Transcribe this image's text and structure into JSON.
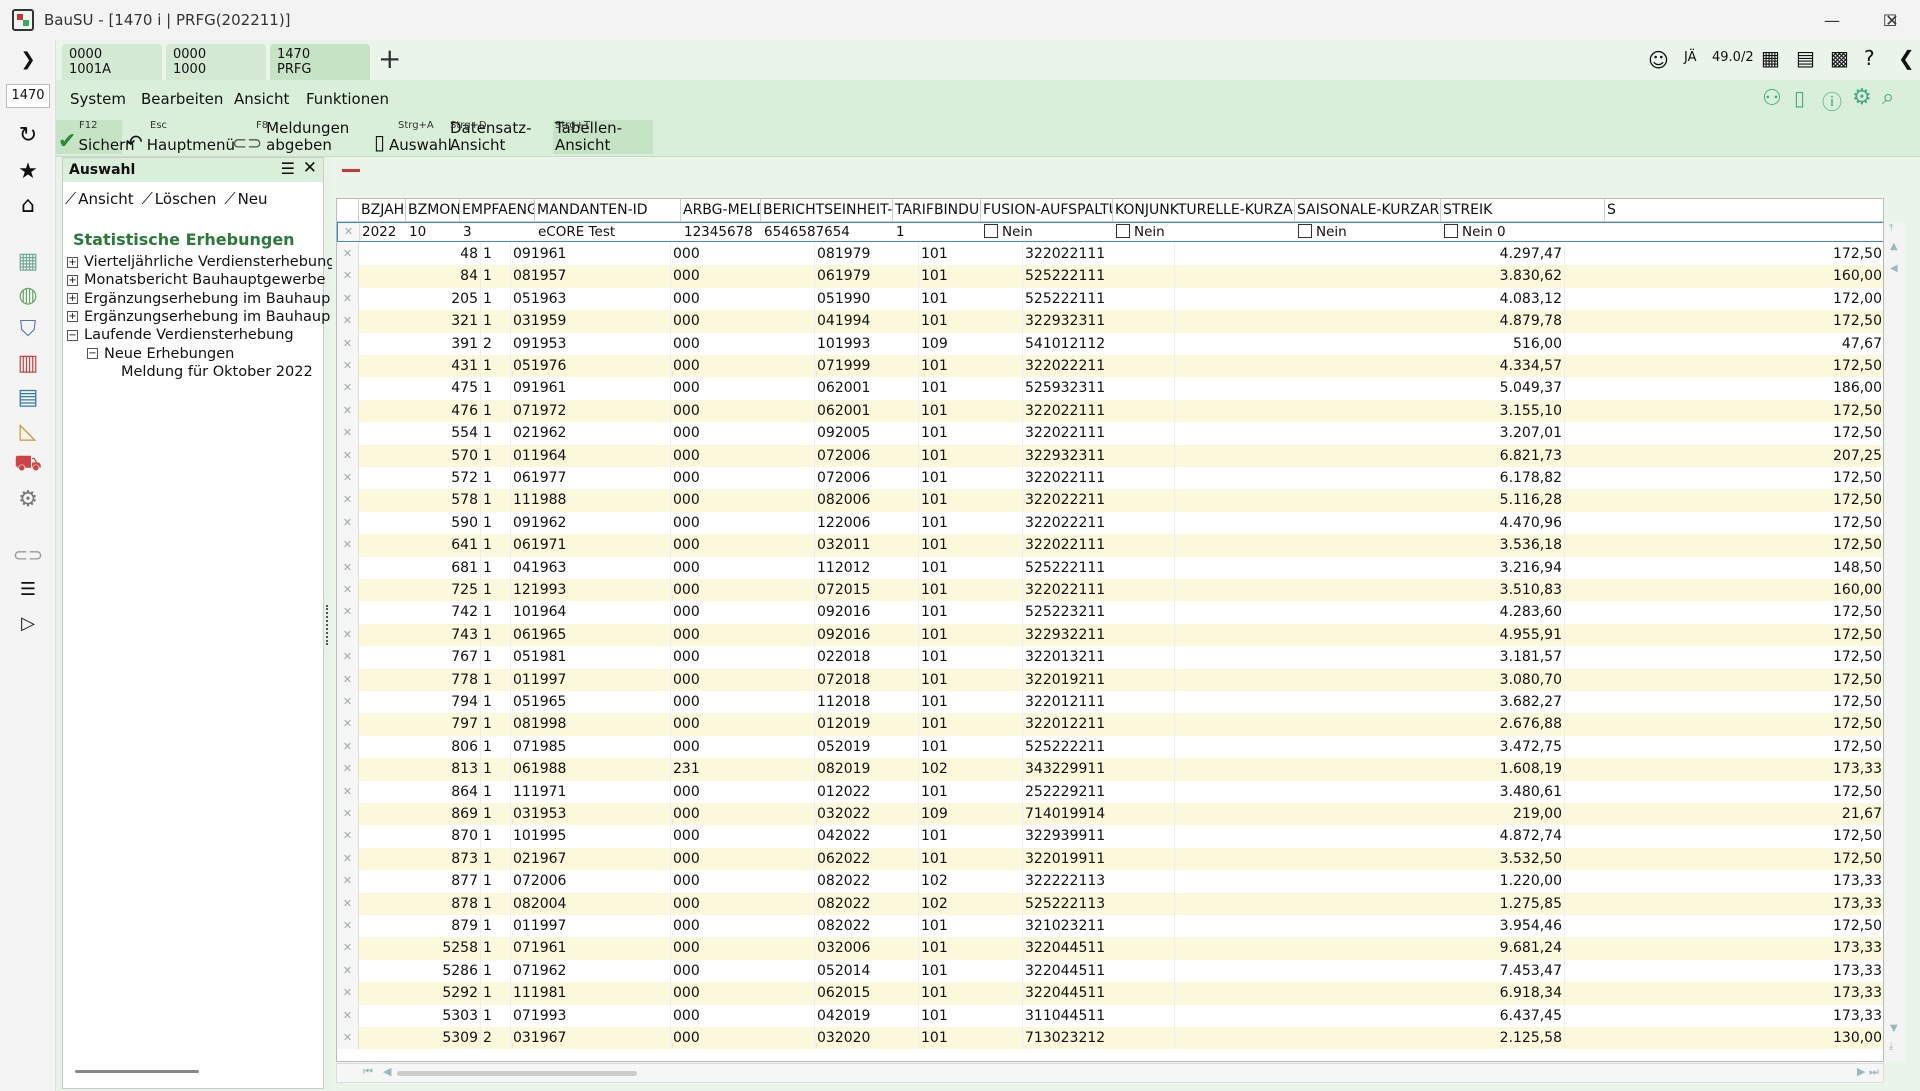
{
  "window": {
    "title": "BauSU - [1470 i | PRFG(202211)]",
    "minimize": "—",
    "maximize": "☐",
    "close": "✕"
  },
  "tabs": [
    {
      "line1": "0000",
      "line2": "1001A"
    },
    {
      "line1": "0000",
      "line2": "1000"
    },
    {
      "line1": "1470",
      "line2": "PRFG"
    }
  ],
  "add_tab": "+",
  "client_field": "1470",
  "user": {
    "initials": "JÄ",
    "version": "49.0/2"
  },
  "menu": [
    "System",
    "Bearbeiten",
    "Ansicht",
    "Funktionen"
  ],
  "toolbar": [
    {
      "key": "F12",
      "label": "Sichern",
      "icon": "check-icon"
    },
    {
      "key": "Esc",
      "label": "Hauptmenü",
      "icon": "undo-icon"
    },
    {
      "key": "F8",
      "label": "Meldungen abgeben",
      "icon": "link-icon"
    },
    {
      "key": "Strg+A",
      "label": "Auswahl",
      "icon": "document-icon"
    },
    {
      "key": "Strg+D",
      "label": "Datensatz-Ansicht",
      "icon": ""
    },
    {
      "key": "Strg+T",
      "label": "Tabellen-Ansicht",
      "icon": ""
    }
  ],
  "sidebar": {
    "title": "Auswahl",
    "tools": [
      "Ansicht",
      "Löschen",
      "Neu"
    ],
    "section": "Statistische Erhebungen",
    "tree": [
      {
        "label": "Vierteljährliche Verdiensterhebung",
        "level": 0,
        "pm": "+"
      },
      {
        "label": "Monatsbericht Bauhauptgewerbe",
        "level": 0,
        "pm": "+"
      },
      {
        "label": "Ergänzungserhebung im Bauhaup",
        "level": 0,
        "pm": "+"
      },
      {
        "label": "Ergänzungserhebung im Bauhaup",
        "level": 0,
        "pm": "+"
      },
      {
        "label": "Laufende Verdiensterhebung",
        "level": 0,
        "pm": "−"
      },
      {
        "label": "Neue Erhebungen",
        "level": 1,
        "pm": "−"
      },
      {
        "label": "Meldung für Oktober 2022",
        "level": 2,
        "pm": ""
      }
    ]
  },
  "grid": {
    "minus_marker": "—",
    "headers": [
      "BZJAHR",
      "BZMONA",
      "EMPFAENGEI",
      "MANDANTEN-ID",
      "ARBG-MELDID",
      "BERICHTSEINHEIT-ID",
      "TARIFBINDUNG",
      "FUSION-AUFSPALTUNG",
      "KONJUNKTURELLE-KURZARBEIT",
      "SAISONALE-KURZARBEIT",
      "STREIK",
      "S"
    ],
    "filter": {
      "bzjahr": "2022",
      "bzmona": "10",
      "empf": "3",
      "mandant": "eCORE Test",
      "arbg": "12345678",
      "bericht": "6546587654",
      "tarif": "1",
      "fusion": "Nein",
      "konj": "Nein",
      "saison": "Nein",
      "streik": "Nein 0"
    },
    "rows": [
      [
        "48",
        "1",
        "091961",
        "000",
        "081979",
        "101",
        "322022111",
        "4.297,47",
        "172,50"
      ],
      [
        "84",
        "1",
        "081957",
        "000",
        "061979",
        "101",
        "525222111",
        "3.830,62",
        "160,00"
      ],
      [
        "205",
        "1",
        "051963",
        "000",
        "051990",
        "101",
        "525222111",
        "4.083,12",
        "172,00"
      ],
      [
        "321",
        "1",
        "031959",
        "000",
        "041994",
        "101",
        "322932311",
        "4.879,78",
        "172,50"
      ],
      [
        "391",
        "2",
        "091953",
        "000",
        "101993",
        "109",
        "541012112",
        "516,00",
        "47,67"
      ],
      [
        "431",
        "1",
        "051976",
        "000",
        "071999",
        "101",
        "322022211",
        "4.334,57",
        "172,50"
      ],
      [
        "475",
        "1",
        "091961",
        "000",
        "062001",
        "101",
        "525932311",
        "5.049,37",
        "186,00"
      ],
      [
        "476",
        "1",
        "071972",
        "000",
        "062001",
        "101",
        "322022111",
        "3.155,10",
        "172,50"
      ],
      [
        "554",
        "1",
        "021962",
        "000",
        "092005",
        "101",
        "322022111",
        "3.207,01",
        "172,50"
      ],
      [
        "570",
        "1",
        "011964",
        "000",
        "072006",
        "101",
        "322932311",
        "6.821,73",
        "207,25"
      ],
      [
        "572",
        "1",
        "061977",
        "000",
        "072006",
        "101",
        "322022111",
        "6.178,82",
        "172,50"
      ],
      [
        "578",
        "1",
        "111988",
        "000",
        "082006",
        "101",
        "322022211",
        "5.116,28",
        "172,50"
      ],
      [
        "590",
        "1",
        "091962",
        "000",
        "122006",
        "101",
        "322022211",
        "4.470,96",
        "172,50"
      ],
      [
        "641",
        "1",
        "061971",
        "000",
        "032011",
        "101",
        "322022111",
        "3.536,18",
        "172,50"
      ],
      [
        "681",
        "1",
        "041963",
        "000",
        "112012",
        "101",
        "525222111",
        "3.216,94",
        "148,50"
      ],
      [
        "725",
        "1",
        "121993",
        "000",
        "072015",
        "101",
        "322022111",
        "3.510,83",
        "160,00"
      ],
      [
        "742",
        "1",
        "101964",
        "000",
        "092016",
        "101",
        "525223211",
        "4.283,60",
        "172,50"
      ],
      [
        "743",
        "1",
        "061965",
        "000",
        "092016",
        "101",
        "322932211",
        "4.955,91",
        "172,50"
      ],
      [
        "767",
        "1",
        "051981",
        "000",
        "022018",
        "101",
        "322013211",
        "3.181,57",
        "172,50"
      ],
      [
        "778",
        "1",
        "011997",
        "000",
        "072018",
        "101",
        "322019211",
        "3.080,70",
        "172,50"
      ],
      [
        "794",
        "1",
        "051965",
        "000",
        "112018",
        "101",
        "322012111",
        "3.682,27",
        "172,50"
      ],
      [
        "797",
        "1",
        "081998",
        "000",
        "012019",
        "101",
        "322012211",
        "2.676,88",
        "172,50"
      ],
      [
        "806",
        "1",
        "071985",
        "000",
        "052019",
        "101",
        "525222211",
        "3.472,75",
        "172,50"
      ],
      [
        "813",
        "1",
        "061988",
        "231",
        "082019",
        "102",
        "343229911",
        "1.608,19",
        "173,33"
      ],
      [
        "864",
        "1",
        "111971",
        "000",
        "012022",
        "101",
        "252229211",
        "3.480,61",
        "172,50"
      ],
      [
        "869",
        "1",
        "031953",
        "000",
        "032022",
        "109",
        "714019914",
        "219,00",
        "21,67"
      ],
      [
        "870",
        "1",
        "101995",
        "000",
        "042022",
        "101",
        "322939911",
        "4.872,74",
        "172,50"
      ],
      [
        "873",
        "1",
        "021967",
        "000",
        "062022",
        "101",
        "322019911",
        "3.532,50",
        "172,50"
      ],
      [
        "877",
        "1",
        "072006",
        "000",
        "082022",
        "102",
        "322222113",
        "1.220,00",
        "173,33"
      ],
      [
        "878",
        "1",
        "082004",
        "000",
        "082022",
        "102",
        "525222113",
        "1.275,85",
        "173,33"
      ],
      [
        "879",
        "1",
        "011997",
        "000",
        "082022",
        "101",
        "321023211",
        "3.954,46",
        "172,50"
      ],
      [
        "5258",
        "1",
        "071961",
        "000",
        "032006",
        "101",
        "322044511",
        "9.681,24",
        "173,33"
      ],
      [
        "5286",
        "1",
        "071962",
        "000",
        "052014",
        "101",
        "322044511",
        "7.453,47",
        "173,33"
      ],
      [
        "5292",
        "1",
        "111981",
        "000",
        "062015",
        "101",
        "322044511",
        "6.918,34",
        "173,33"
      ],
      [
        "5303",
        "1",
        "071993",
        "000",
        "042019",
        "101",
        "311044511",
        "6.437,45",
        "173,33"
      ],
      [
        "5309",
        "2",
        "031967",
        "000",
        "032020",
        "101",
        "713023212",
        "2.125,58",
        "130,00"
      ]
    ]
  }
}
